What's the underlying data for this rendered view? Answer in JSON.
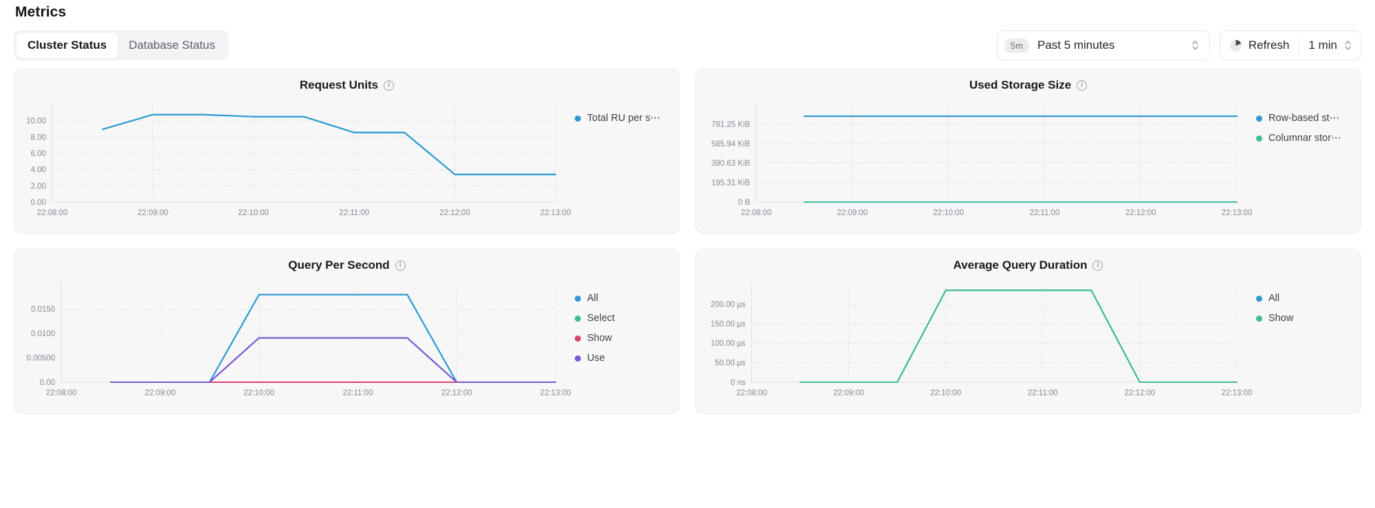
{
  "header": {
    "title": "Metrics",
    "tabs": [
      {
        "label": "Cluster Status",
        "active": true
      },
      {
        "label": "Database Status",
        "active": false
      }
    ]
  },
  "toolbar": {
    "time_picker": {
      "badge": "5m",
      "value": "Past 5 minutes",
      "stepper_up": "⌃",
      "stepper_down": "⌄"
    },
    "refresh": {
      "label": "Refresh",
      "interval": "1 min"
    }
  },
  "colors": {
    "blue": "#2E9AD0",
    "green": "#3DBA97",
    "pink": "#D6436E",
    "purple": "#7B57D1",
    "card_bg": "#F7F7F8",
    "card_border": "#ECECEE",
    "text": "#1F2329",
    "muted": "#9298A0"
  },
  "charts": [
    {
      "title": "Request Units",
      "info_icon": "info-icon",
      "legend": [
        {
          "label": "Total RU per s⋯",
          "color": "#2E9AD0"
        }
      ]
    },
    {
      "title": "Used Storage Size",
      "info_icon": "info-icon",
      "legend": [
        {
          "label": "Row-based st⋯",
          "color": "#2E9AD0"
        },
        {
          "label": "Columnar stor⋯",
          "color": "#3DBA97"
        }
      ]
    },
    {
      "title": "Query Per Second",
      "info_icon": "info-icon",
      "legend": [
        {
          "label": "All",
          "color": "#2E9AD0"
        },
        {
          "label": "Select",
          "color": "#3DBA97"
        },
        {
          "label": "Show",
          "color": "#D6436E"
        },
        {
          "label": "Use",
          "color": "#7B57D1"
        }
      ]
    },
    {
      "title": "Average Query Duration",
      "info_icon": "info-icon",
      "legend": [
        {
          "label": "All",
          "color": "#2E9AD0"
        },
        {
          "label": "Show",
          "color": "#3DBA97"
        }
      ]
    }
  ],
  "chart_data": [
    {
      "type": "line",
      "title": "Request Units",
      "xlabel": "",
      "ylabel": "",
      "x": [
        "22:08:00",
        "22:09:00",
        "22:10:00",
        "22:11:00",
        "22:12:00",
        "22:13:00"
      ],
      "xticks": [
        "22:08:00",
        "22:09:00",
        "22:10:00",
        "22:11:00",
        "22:12:00",
        "22:13:00"
      ],
      "yticks": [
        "0.00",
        "2.00",
        "4.00",
        "6.00",
        "8.00",
        "10.00"
      ],
      "ylim": [
        0,
        12
      ],
      "grid": true,
      "legend_position": "right",
      "series": [
        {
          "name": "Total RU per s⋯",
          "color": "#2E9AD0",
          "points": [
            {
              "t": "22:08:30",
              "v": 8.95
            },
            {
              "t": "22:09:00",
              "v": 10.75
            },
            {
              "t": "22:09:30",
              "v": 10.75
            },
            {
              "t": "22:10:00",
              "v": 10.5
            },
            {
              "t": "22:10:30",
              "v": 10.5
            },
            {
              "t": "22:11:00",
              "v": 8.55
            },
            {
              "t": "22:11:30",
              "v": 8.55
            },
            {
              "t": "22:12:00",
              "v": 3.4
            },
            {
              "t": "22:12:30",
              "v": 3.4
            },
            {
              "t": "22:13:00",
              "v": 3.4
            }
          ]
        }
      ]
    },
    {
      "type": "line",
      "title": "Used Storage Size",
      "xlabel": "",
      "ylabel": "",
      "x": [
        "22:08:00",
        "22:09:00",
        "22:10:00",
        "22:11:00",
        "22:12:00",
        "22:13:00"
      ],
      "xticks": [
        "22:08:00",
        "22:09:00",
        "22:10:00",
        "22:11:00",
        "22:12:00",
        "22:13:00"
      ],
      "yticks": [
        "0 B",
        "195.31 KiB",
        "390.63 KiB",
        "585.94 KiB",
        "781.25 KiB"
      ],
      "ylim": [
        0,
        976562
      ],
      "grid": true,
      "legend_position": "right",
      "series": [
        {
          "name": "Row-based st⋯",
          "color": "#2E9AD0",
          "points": [
            {
              "t": "22:08:30",
              "v": 859375
            },
            {
              "t": "22:13:00",
              "v": 859375
            }
          ]
        },
        {
          "name": "Columnar stor⋯",
          "color": "#3DBA97",
          "points": [
            {
              "t": "22:08:30",
              "v": 0
            },
            {
              "t": "22:13:00",
              "v": 0
            }
          ]
        }
      ]
    },
    {
      "type": "line",
      "title": "Query Per Second",
      "xlabel": "",
      "ylabel": "",
      "x": [
        "22:08:00",
        "22:09:00",
        "22:10:00",
        "22:11:00",
        "22:12:00",
        "22:13:00"
      ],
      "xticks": [
        "22:08:00",
        "22:09:00",
        "22:10:00",
        "22:11:00",
        "22:12:00",
        "22:13:00"
      ],
      "yticks": [
        "0.00",
        "0.00500",
        "0.0100",
        "0.0150"
      ],
      "ylim": [
        0,
        0.0185
      ],
      "grid": true,
      "legend_position": "right",
      "series": [
        {
          "name": "All",
          "color": "#2E9AD0",
          "points": [
            {
              "t": "22:08:30",
              "v": 0
            },
            {
              "t": "22:09:30",
              "v": 0
            },
            {
              "t": "22:10:00",
              "v": 0.0166
            },
            {
              "t": "22:11:30",
              "v": 0.0166
            },
            {
              "t": "22:12:00",
              "v": 0
            },
            {
              "t": "22:13:00",
              "v": 0
            }
          ]
        },
        {
          "name": "Select",
          "color": "#3DBA97",
          "points": [
            {
              "t": "22:08:30",
              "v": 0
            },
            {
              "t": "22:13:00",
              "v": 0
            }
          ]
        },
        {
          "name": "Show",
          "color": "#D6436E",
          "points": [
            {
              "t": "22:08:30",
              "v": 0
            },
            {
              "t": "22:13:00",
              "v": 0
            }
          ]
        },
        {
          "name": "Use",
          "color": "#7B57D1",
          "points": [
            {
              "t": "22:08:30",
              "v": 0
            },
            {
              "t": "22:09:30",
              "v": 0
            },
            {
              "t": "22:10:00",
              "v": 0.0084
            },
            {
              "t": "22:11:30",
              "v": 0.0084
            },
            {
              "t": "22:12:00",
              "v": 0
            },
            {
              "t": "22:13:00",
              "v": 0
            }
          ]
        }
      ]
    },
    {
      "type": "line",
      "title": "Average Query Duration",
      "xlabel": "",
      "ylabel": "",
      "x": [
        "22:08:00",
        "22:09:00",
        "22:10:00",
        "22:11:00",
        "22:12:00",
        "22:13:00"
      ],
      "xticks": [
        "22:08:00",
        "22:09:00",
        "22:10:00",
        "22:11:00",
        "22:12:00",
        "22:13:00"
      ],
      "yticks": [
        "0 ns",
        "50.00 µs",
        "100.00 µs",
        "150.00 µs",
        "200.00 µs"
      ],
      "ylim": [
        0,
        255
      ],
      "grid": true,
      "legend_position": "right",
      "series": [
        {
          "name": "All",
          "color": "#2E9AD0",
          "points": []
        },
        {
          "name": "Show",
          "color": "#3DBA97",
          "points": [
            {
              "t": "22:08:30",
              "v": 0
            },
            {
              "t": "22:09:30",
              "v": 0
            },
            {
              "t": "22:10:00",
              "v": 240
            },
            {
              "t": "22:11:30",
              "v": 240
            },
            {
              "t": "22:12:00",
              "v": 0
            },
            {
              "t": "22:13:00",
              "v": 0
            }
          ]
        }
      ]
    }
  ]
}
